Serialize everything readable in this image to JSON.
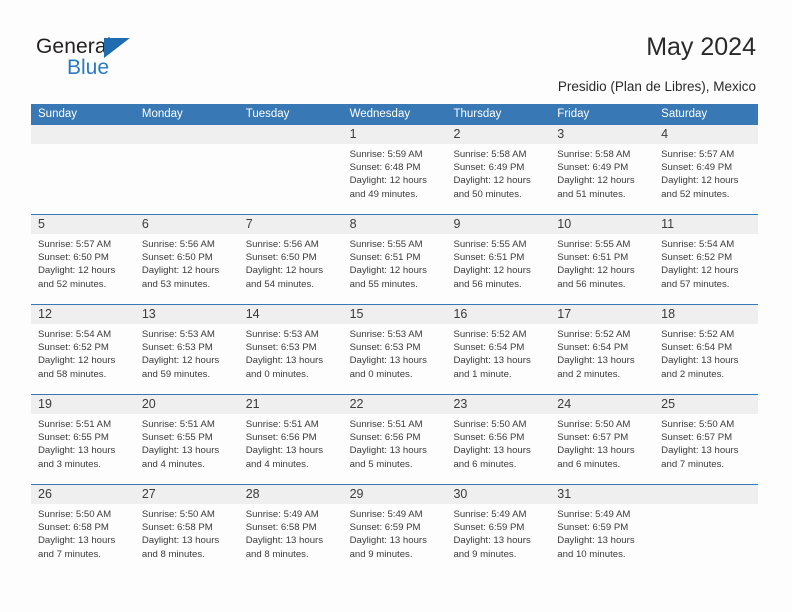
{
  "logo": {
    "word_top": "General",
    "word_bottom": "Blue",
    "triangle_icon": "triangle-icon",
    "accent_color": "#1f6cb0",
    "text_color": "#231f20"
  },
  "header": {
    "title": "May 2024",
    "subtitle": "Presidio (Plan de Libres), Mexico"
  },
  "theme": {
    "header_blue": "#3778b5",
    "daynum_band": "#efefef",
    "page_bg": "#fdfdfd",
    "text": "#3b3b3b"
  },
  "calendar": {
    "day_names": [
      "Sunday",
      "Monday",
      "Tuesday",
      "Wednesday",
      "Thursday",
      "Friday",
      "Saturday"
    ],
    "weeks": [
      [
        {
          "day": "",
          "sunrise": "",
          "sunset": "",
          "daylight_line1": "",
          "daylight_line2": ""
        },
        {
          "day": "",
          "sunrise": "",
          "sunset": "",
          "daylight_line1": "",
          "daylight_line2": ""
        },
        {
          "day": "",
          "sunrise": "",
          "sunset": "",
          "daylight_line1": "",
          "daylight_line2": ""
        },
        {
          "day": "1",
          "sunrise": "Sunrise: 5:59 AM",
          "sunset": "Sunset: 6:48 PM",
          "daylight_line1": "Daylight: 12 hours",
          "daylight_line2": "and 49 minutes."
        },
        {
          "day": "2",
          "sunrise": "Sunrise: 5:58 AM",
          "sunset": "Sunset: 6:49 PM",
          "daylight_line1": "Daylight: 12 hours",
          "daylight_line2": "and 50 minutes."
        },
        {
          "day": "3",
          "sunrise": "Sunrise: 5:58 AM",
          "sunset": "Sunset: 6:49 PM",
          "daylight_line1": "Daylight: 12 hours",
          "daylight_line2": "and 51 minutes."
        },
        {
          "day": "4",
          "sunrise": "Sunrise: 5:57 AM",
          "sunset": "Sunset: 6:49 PM",
          "daylight_line1": "Daylight: 12 hours",
          "daylight_line2": "and 52 minutes."
        }
      ],
      [
        {
          "day": "5",
          "sunrise": "Sunrise: 5:57 AM",
          "sunset": "Sunset: 6:50 PM",
          "daylight_line1": "Daylight: 12 hours",
          "daylight_line2": "and 52 minutes."
        },
        {
          "day": "6",
          "sunrise": "Sunrise: 5:56 AM",
          "sunset": "Sunset: 6:50 PM",
          "daylight_line1": "Daylight: 12 hours",
          "daylight_line2": "and 53 minutes."
        },
        {
          "day": "7",
          "sunrise": "Sunrise: 5:56 AM",
          "sunset": "Sunset: 6:50 PM",
          "daylight_line1": "Daylight: 12 hours",
          "daylight_line2": "and 54 minutes."
        },
        {
          "day": "8",
          "sunrise": "Sunrise: 5:55 AM",
          "sunset": "Sunset: 6:51 PM",
          "daylight_line1": "Daylight: 12 hours",
          "daylight_line2": "and 55 minutes."
        },
        {
          "day": "9",
          "sunrise": "Sunrise: 5:55 AM",
          "sunset": "Sunset: 6:51 PM",
          "daylight_line1": "Daylight: 12 hours",
          "daylight_line2": "and 56 minutes."
        },
        {
          "day": "10",
          "sunrise": "Sunrise: 5:55 AM",
          "sunset": "Sunset: 6:51 PM",
          "daylight_line1": "Daylight: 12 hours",
          "daylight_line2": "and 56 minutes."
        },
        {
          "day": "11",
          "sunrise": "Sunrise: 5:54 AM",
          "sunset": "Sunset: 6:52 PM",
          "daylight_line1": "Daylight: 12 hours",
          "daylight_line2": "and 57 minutes."
        }
      ],
      [
        {
          "day": "12",
          "sunrise": "Sunrise: 5:54 AM",
          "sunset": "Sunset: 6:52 PM",
          "daylight_line1": "Daylight: 12 hours",
          "daylight_line2": "and 58 minutes."
        },
        {
          "day": "13",
          "sunrise": "Sunrise: 5:53 AM",
          "sunset": "Sunset: 6:53 PM",
          "daylight_line1": "Daylight: 12 hours",
          "daylight_line2": "and 59 minutes."
        },
        {
          "day": "14",
          "sunrise": "Sunrise: 5:53 AM",
          "sunset": "Sunset: 6:53 PM",
          "daylight_line1": "Daylight: 13 hours",
          "daylight_line2": "and 0 minutes."
        },
        {
          "day": "15",
          "sunrise": "Sunrise: 5:53 AM",
          "sunset": "Sunset: 6:53 PM",
          "daylight_line1": "Daylight: 13 hours",
          "daylight_line2": "and 0 minutes."
        },
        {
          "day": "16",
          "sunrise": "Sunrise: 5:52 AM",
          "sunset": "Sunset: 6:54 PM",
          "daylight_line1": "Daylight: 13 hours",
          "daylight_line2": "and 1 minute."
        },
        {
          "day": "17",
          "sunrise": "Sunrise: 5:52 AM",
          "sunset": "Sunset: 6:54 PM",
          "daylight_line1": "Daylight: 13 hours",
          "daylight_line2": "and 2 minutes."
        },
        {
          "day": "18",
          "sunrise": "Sunrise: 5:52 AM",
          "sunset": "Sunset: 6:54 PM",
          "daylight_line1": "Daylight: 13 hours",
          "daylight_line2": "and 2 minutes."
        }
      ],
      [
        {
          "day": "19",
          "sunrise": "Sunrise: 5:51 AM",
          "sunset": "Sunset: 6:55 PM",
          "daylight_line1": "Daylight: 13 hours",
          "daylight_line2": "and 3 minutes."
        },
        {
          "day": "20",
          "sunrise": "Sunrise: 5:51 AM",
          "sunset": "Sunset: 6:55 PM",
          "daylight_line1": "Daylight: 13 hours",
          "daylight_line2": "and 4 minutes."
        },
        {
          "day": "21",
          "sunrise": "Sunrise: 5:51 AM",
          "sunset": "Sunset: 6:56 PM",
          "daylight_line1": "Daylight: 13 hours",
          "daylight_line2": "and 4 minutes."
        },
        {
          "day": "22",
          "sunrise": "Sunrise: 5:51 AM",
          "sunset": "Sunset: 6:56 PM",
          "daylight_line1": "Daylight: 13 hours",
          "daylight_line2": "and 5 minutes."
        },
        {
          "day": "23",
          "sunrise": "Sunrise: 5:50 AM",
          "sunset": "Sunset: 6:56 PM",
          "daylight_line1": "Daylight: 13 hours",
          "daylight_line2": "and 6 minutes."
        },
        {
          "day": "24",
          "sunrise": "Sunrise: 5:50 AM",
          "sunset": "Sunset: 6:57 PM",
          "daylight_line1": "Daylight: 13 hours",
          "daylight_line2": "and 6 minutes."
        },
        {
          "day": "25",
          "sunrise": "Sunrise: 5:50 AM",
          "sunset": "Sunset: 6:57 PM",
          "daylight_line1": "Daylight: 13 hours",
          "daylight_line2": "and 7 minutes."
        }
      ],
      [
        {
          "day": "26",
          "sunrise": "Sunrise: 5:50 AM",
          "sunset": "Sunset: 6:58 PM",
          "daylight_line1": "Daylight: 13 hours",
          "daylight_line2": "and 7 minutes."
        },
        {
          "day": "27",
          "sunrise": "Sunrise: 5:50 AM",
          "sunset": "Sunset: 6:58 PM",
          "daylight_line1": "Daylight: 13 hours",
          "daylight_line2": "and 8 minutes."
        },
        {
          "day": "28",
          "sunrise": "Sunrise: 5:49 AM",
          "sunset": "Sunset: 6:58 PM",
          "daylight_line1": "Daylight: 13 hours",
          "daylight_line2": "and 8 minutes."
        },
        {
          "day": "29",
          "sunrise": "Sunrise: 5:49 AM",
          "sunset": "Sunset: 6:59 PM",
          "daylight_line1": "Daylight: 13 hours",
          "daylight_line2": "and 9 minutes."
        },
        {
          "day": "30",
          "sunrise": "Sunrise: 5:49 AM",
          "sunset": "Sunset: 6:59 PM",
          "daylight_line1": "Daylight: 13 hours",
          "daylight_line2": "and 9 minutes."
        },
        {
          "day": "31",
          "sunrise": "Sunrise: 5:49 AM",
          "sunset": "Sunset: 6:59 PM",
          "daylight_line1": "Daylight: 13 hours",
          "daylight_line2": "and 10 minutes."
        },
        {
          "day": "",
          "sunrise": "",
          "sunset": "",
          "daylight_line1": "",
          "daylight_line2": ""
        }
      ]
    ]
  }
}
